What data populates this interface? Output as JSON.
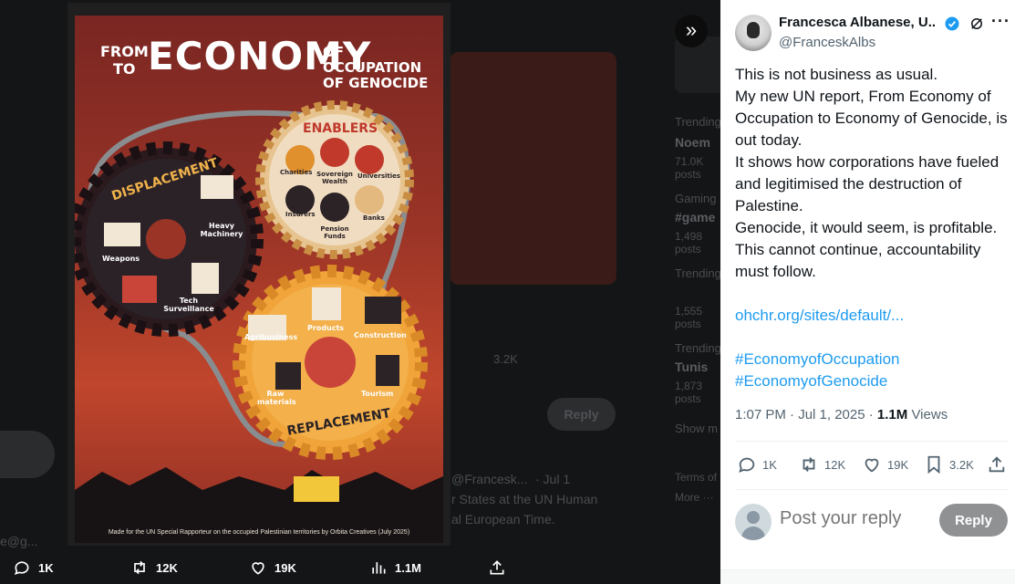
{
  "backdrop": {
    "trending_1_label": "Trending",
    "trending_1_topic": "Noem",
    "trending_1_count": "71.0K posts",
    "trending_2_label": "Gaming",
    "trending_2_topic": "#game",
    "trending_2_count": "1,498 posts",
    "trending_3_label": "Trending",
    "trending_3_count": "1,555 posts",
    "trending_4_label": "Trending",
    "trending_4_topic": "Tunis",
    "trending_4_count": "1,873 posts",
    "show_more": "Show m",
    "reply_label": "Reply",
    "bookmark_count": "3.2K",
    "quoted_handle": "@Francesk...",
    "quoted_time": "· Jul 1",
    "quoted_line_1": "r States at the UN Human",
    "quoted_line_2": "al European Time.",
    "terms": "Terms of",
    "more": "More ···",
    "email_fragment": "e@g...",
    "media_caption": "Made for the UN Special Rapporteur on the occupied Palestinian territories by Orbita Creatives (July 2025)"
  },
  "poster": {
    "title_from": "FROM",
    "title_to": "TO",
    "title_economy": "ECONOMY",
    "title_of_occupation": "OF OCCUPATION",
    "title_of_genocide": "OF GENOCIDE",
    "enablers_label": "ENABLERS",
    "enablers_items": [
      "Charities",
      "Sovereign Wealth",
      "Universities",
      "Insurers",
      "Pension Funds",
      "Banks"
    ],
    "displacement_label": "DISPLACEMENT",
    "displacement_items": [
      "Heavy Machinery",
      "Weapons",
      "Tech Surveillance"
    ],
    "replacement_label": "REPLACEMENT",
    "replacement_items": [
      "Agribusiness",
      "Products",
      "Construction",
      "Raw materials",
      "Tourism"
    ],
    "credit": "Made for the UN Special Rapporteur on the occupied Palestinian territories by Orbita Creatives (July 2025)"
  },
  "media_bar": {
    "replies": "1K",
    "reposts": "12K",
    "likes": "19K",
    "views": "1.1M"
  },
  "tweet": {
    "author_name": "Francesca Albanese, U...",
    "author_handle": "@FranceskAlbs",
    "line_1": "This is not business as usual.",
    "line_2": "My new UN report, From Economy of Occupation to Economy of Genocide, is out today.",
    "line_3": "It shows how corporations have fueled and legitimised the destruction of Palestine.",
    "line_4": "Genocide, it would seem, is profitable.",
    "line_5": "This cannot continue, accountability must follow.",
    "link": "ohchr.org/sites/default/...",
    "hashtag_1": "#EconomyofOccupation",
    "hashtag_2": "#EconomyofGenocide",
    "time": "1:07 PM · Jul 1, 2025 ·",
    "views_count": "1.1M",
    "views_label": "Views",
    "replies": "1K",
    "reposts": "12K",
    "likes": "19K",
    "bookmarks": "3.2K"
  },
  "reply_box": {
    "placeholder": "Post your reply",
    "button": "Reply"
  },
  "colors": {
    "accent": "#1d9bf0",
    "verified": "#1d9bf0",
    "poster_red": "#9a3427",
    "poster_orange": "#f0a43a"
  }
}
